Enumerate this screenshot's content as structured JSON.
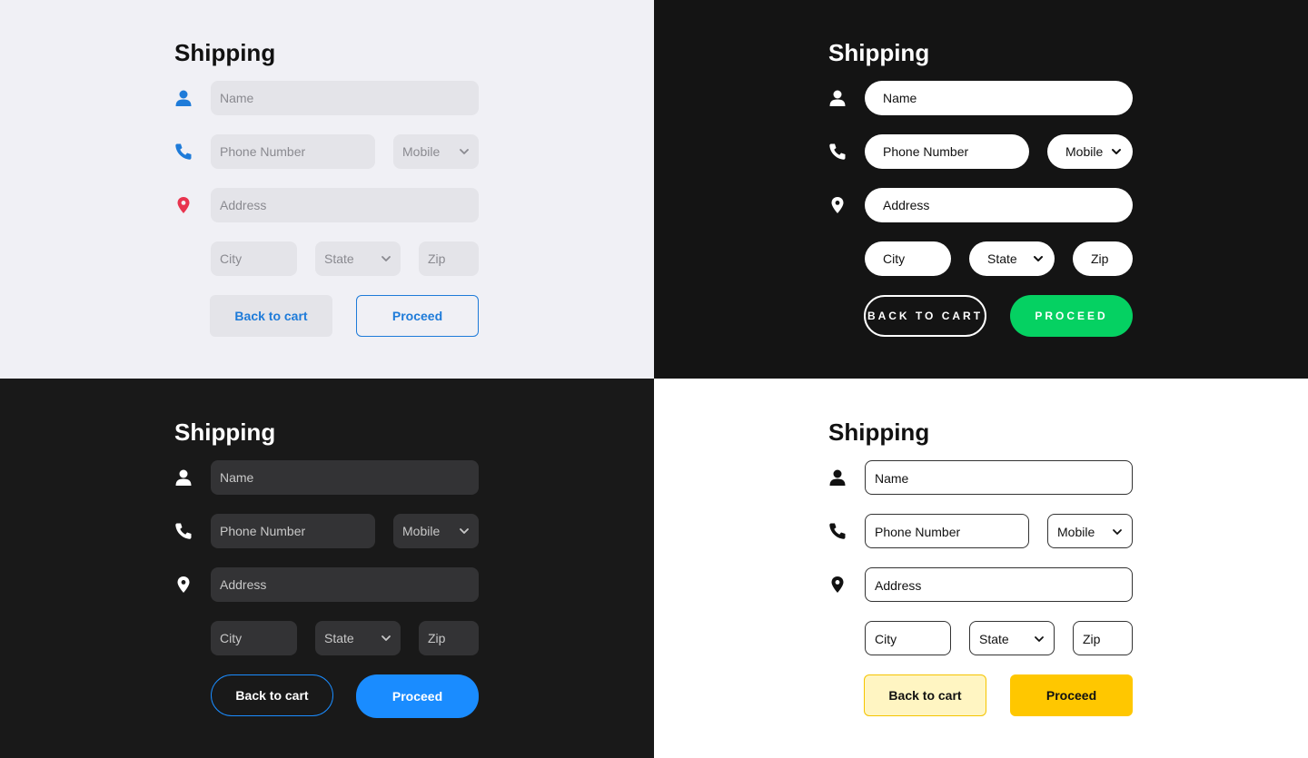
{
  "colors": {
    "light_accent": "#1e7bd9",
    "pin_red": "#e8344f",
    "green": "#05d162",
    "blue": "#1a8cff",
    "yellow": "#ffc700"
  },
  "icons": [
    "user-icon",
    "phone-icon",
    "location-pin-icon",
    "chevron-down-icon"
  ],
  "panels": [
    {
      "title": "Shipping",
      "name_placeholder": "Name",
      "phone_placeholder": "Phone Number",
      "phone_type": "Mobile",
      "address_placeholder": "Address",
      "city_placeholder": "City",
      "state": "State",
      "zip_placeholder": "Zip",
      "back_label": "Back to cart",
      "proceed_label": "Proceed"
    },
    {
      "title": "Shipping",
      "name_placeholder": "Name",
      "phone_placeholder": "Phone Number",
      "phone_type": "Mobile",
      "address_placeholder": "Address",
      "city_placeholder": "City",
      "state": "State",
      "zip_placeholder": "Zip",
      "back_label": "BACK TO CART",
      "proceed_label": "PROCEED"
    },
    {
      "title": "Shipping",
      "name_placeholder": "Name",
      "phone_placeholder": "Phone Number",
      "phone_type": "Mobile",
      "address_placeholder": "Address",
      "city_placeholder": "City",
      "state": "State",
      "zip_placeholder": "Zip",
      "back_label": "Back to cart",
      "proceed_label": "Proceed"
    },
    {
      "title": "Shipping",
      "name_placeholder": "Name",
      "phone_placeholder": "Phone Number",
      "phone_type": "Mobile",
      "address_placeholder": "Address",
      "city_placeholder": "City",
      "state": "State",
      "zip_placeholder": "Zip",
      "back_label": "Back to cart",
      "proceed_label": "Proceed"
    }
  ]
}
